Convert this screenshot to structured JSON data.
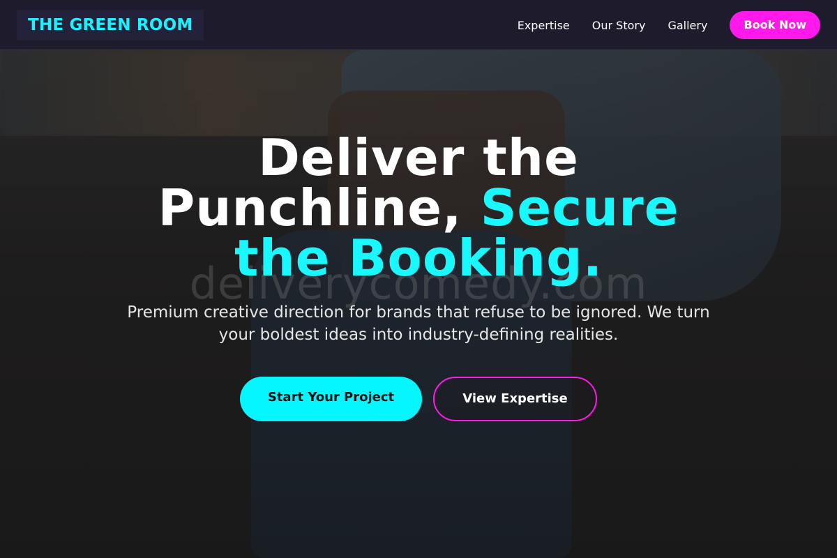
{
  "header": {
    "logo": "THE GREEN ROOM",
    "nav": [
      "Expertise",
      "Our Story",
      "Gallery"
    ],
    "cta": "Book Now"
  },
  "hero": {
    "title_part1": "Deliver the Punchline, ",
    "title_accent": "Secure the Booking.",
    "subtitle": "Premium creative direction for brands that refuse to be ignored. We turn your boldest ideas into industry-defining realities.",
    "primary_button": "Start Your Project",
    "secondary_button": "View Expertise"
  },
  "background": {
    "watermark": "deliverycomedy.com"
  },
  "colors": {
    "accent_cyan": "#05f6ff",
    "accent_magenta": "#ff19ea",
    "navbar_bg": "#1d1b2c"
  }
}
